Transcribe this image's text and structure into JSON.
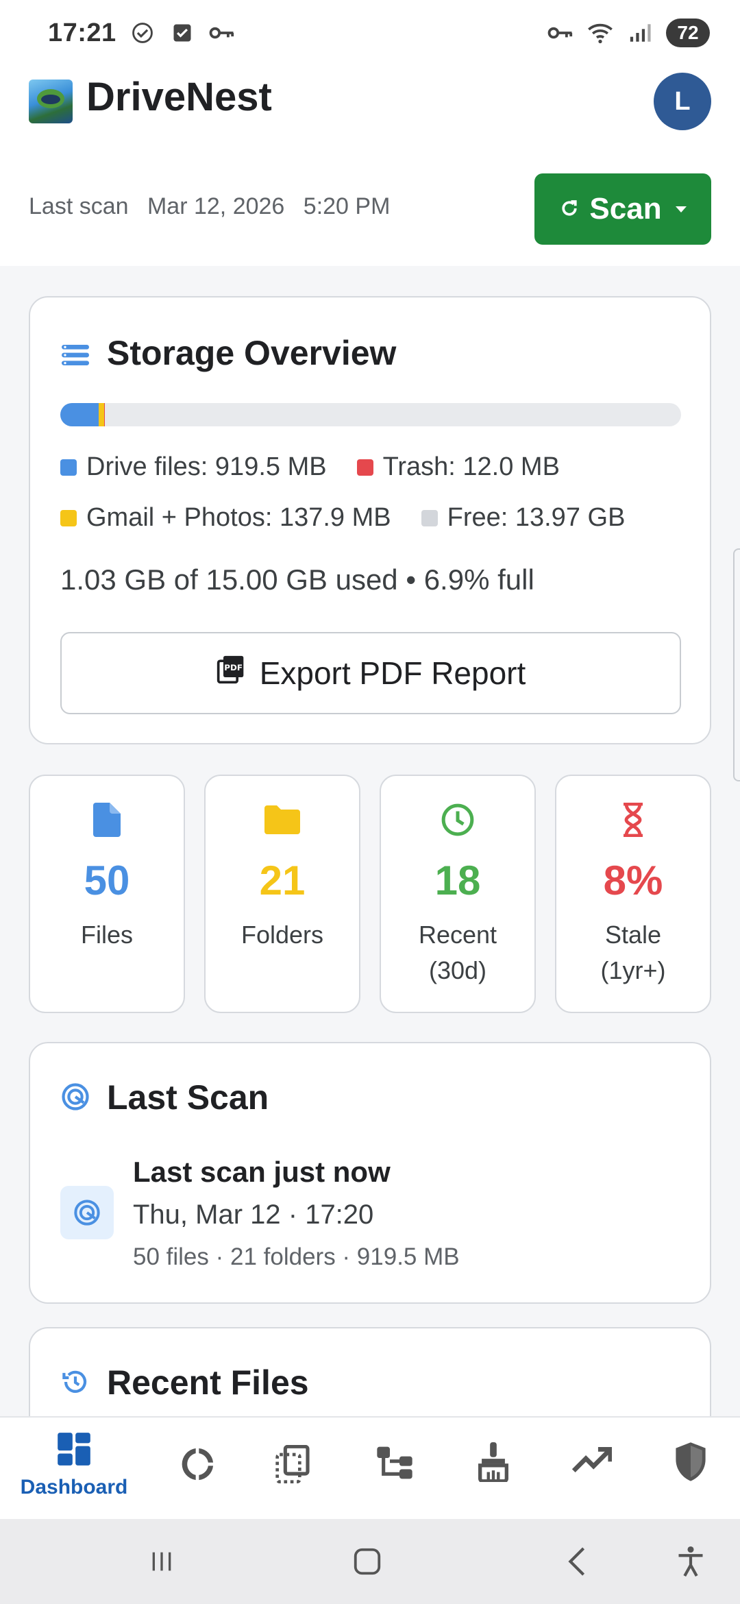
{
  "status_bar": {
    "time": "17:21",
    "battery": "72",
    "left_icons": [
      "check-circle-icon",
      "checkbox-icon",
      "key-icon"
    ],
    "right_icons": [
      "key-icon",
      "wifi-icon",
      "signal-icon"
    ]
  },
  "app": {
    "title": "DriveNest",
    "avatar_initial": "L",
    "last_scan_label": "Last scan",
    "last_scan_date": "Mar 12, 2026",
    "last_scan_time": "5:20 PM",
    "scan_button": "Scan"
  },
  "storage": {
    "title": "Storage Overview",
    "usage_text": "1.03 GB of 15.00 GB used  •  6.9% full",
    "export_button": "Export PDF Report",
    "legend": [
      {
        "label": "Drive files: 919.5 MB",
        "color": "#4a90e2"
      },
      {
        "label": "Trash: 12.0 MB",
        "color": "#e5484d"
      },
      {
        "label": "Gmail + Photos: 137.9 MB",
        "color": "#f5c518"
      },
      {
        "label": "Free: 13.97 GB",
        "color": "#d3d6db"
      }
    ],
    "bar_fractions": {
      "drive": 0.0613,
      "gmail_photos": 0.0092,
      "trash": 0.0008
    }
  },
  "stats": [
    {
      "value": "50",
      "label": "Files",
      "color": "#4a90e2",
      "icon": "file-icon"
    },
    {
      "value": "21",
      "label": "Folders",
      "color": "#f5c518",
      "icon": "folder-icon"
    },
    {
      "value": "18",
      "label": "Recent\n(30d)",
      "label_1": "Recent",
      "label_2": "(30d)",
      "color": "#4caf50",
      "icon": "clock-icon"
    },
    {
      "value": "8%",
      "label": "Stale\n(1yr+)",
      "label_1": "Stale",
      "label_2": "(1yr+)",
      "color": "#e5484d",
      "icon": "hourglass-icon"
    }
  ],
  "last_scan": {
    "title": "Last Scan",
    "headline": "Last scan just now",
    "date": "Thu, Mar 12 · 17:20",
    "summary": "50 files · 21 folders · 919.5 MB"
  },
  "recent_files": {
    "title": "Recent Files"
  },
  "bottom_nav": {
    "active_label": "Dashboard",
    "items": [
      "dashboard-icon",
      "donut-chart-icon",
      "duplicates-icon",
      "tree-icon",
      "cleanup-brush-icon",
      "trending-icon",
      "shield-icon"
    ]
  }
}
